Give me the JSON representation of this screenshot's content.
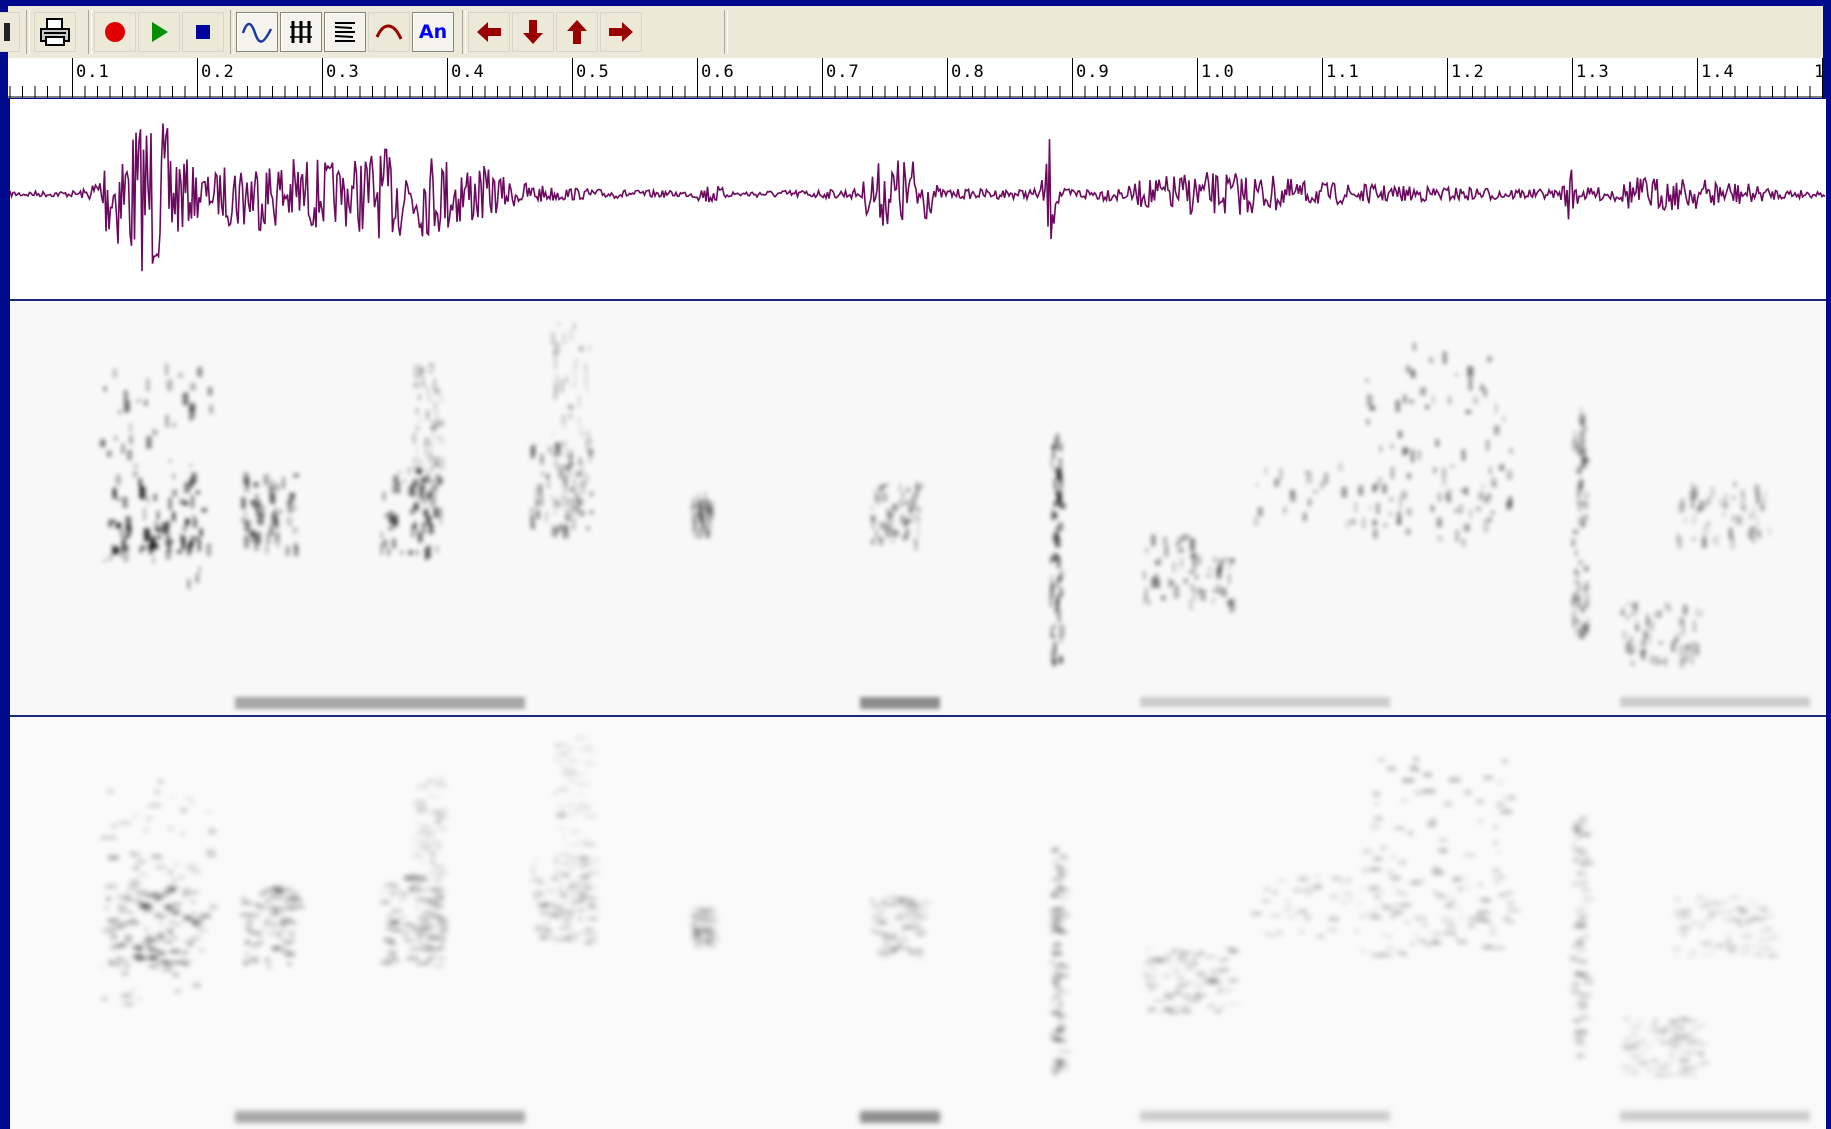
{
  "toolbar": {
    "buttons": [
      {
        "name": "open-button",
        "icon": "folder-icon",
        "pressed": false
      },
      {
        "name": "print-button",
        "icon": "printer-icon",
        "pressed": false
      },
      {
        "name": "record-button",
        "icon": "record-icon",
        "pressed": false
      },
      {
        "name": "play-button",
        "icon": "play-icon",
        "pressed": false
      },
      {
        "name": "stop-button",
        "icon": "stop-icon",
        "pressed": false
      },
      {
        "name": "waveform-view-button",
        "icon": "waveform-icon",
        "pressed": true
      },
      {
        "name": "wideband-spectrogram-button",
        "icon": "wideband-icon",
        "pressed": true
      },
      {
        "name": "narrowband-spectrogram-button",
        "icon": "narrowband-icon",
        "pressed": true
      },
      {
        "name": "pitch-button",
        "icon": "pitch-curve-icon",
        "pressed": false
      },
      {
        "name": "annotation-button",
        "icon": "annotation-icon",
        "label": "An",
        "pressed": true
      },
      {
        "name": "scroll-left-button",
        "icon": "arrow-left-icon",
        "pressed": false
      },
      {
        "name": "zoom-in-button",
        "icon": "arrow-down-icon",
        "pressed": false
      },
      {
        "name": "zoom-out-button",
        "icon": "arrow-up-icon",
        "pressed": false
      },
      {
        "name": "scroll-right-button",
        "icon": "arrow-right-icon",
        "pressed": false
      }
    ]
  },
  "ruler": {
    "labels": [
      "0.1",
      "0.2",
      "0.3",
      "0.4",
      "0.5",
      "0.6",
      "0.7",
      "0.8",
      "0.9",
      "1.0",
      "1.1",
      "1.2",
      "1.3",
      "1.4",
      "1"
    ]
  },
  "colors": {
    "frame": "#000a8c",
    "waveform": "#6b0a5e",
    "record": "#e00000",
    "play": "#009000",
    "stop": "#0000a0",
    "arrow": "#9a0000",
    "annotation": "#0000ff"
  }
}
